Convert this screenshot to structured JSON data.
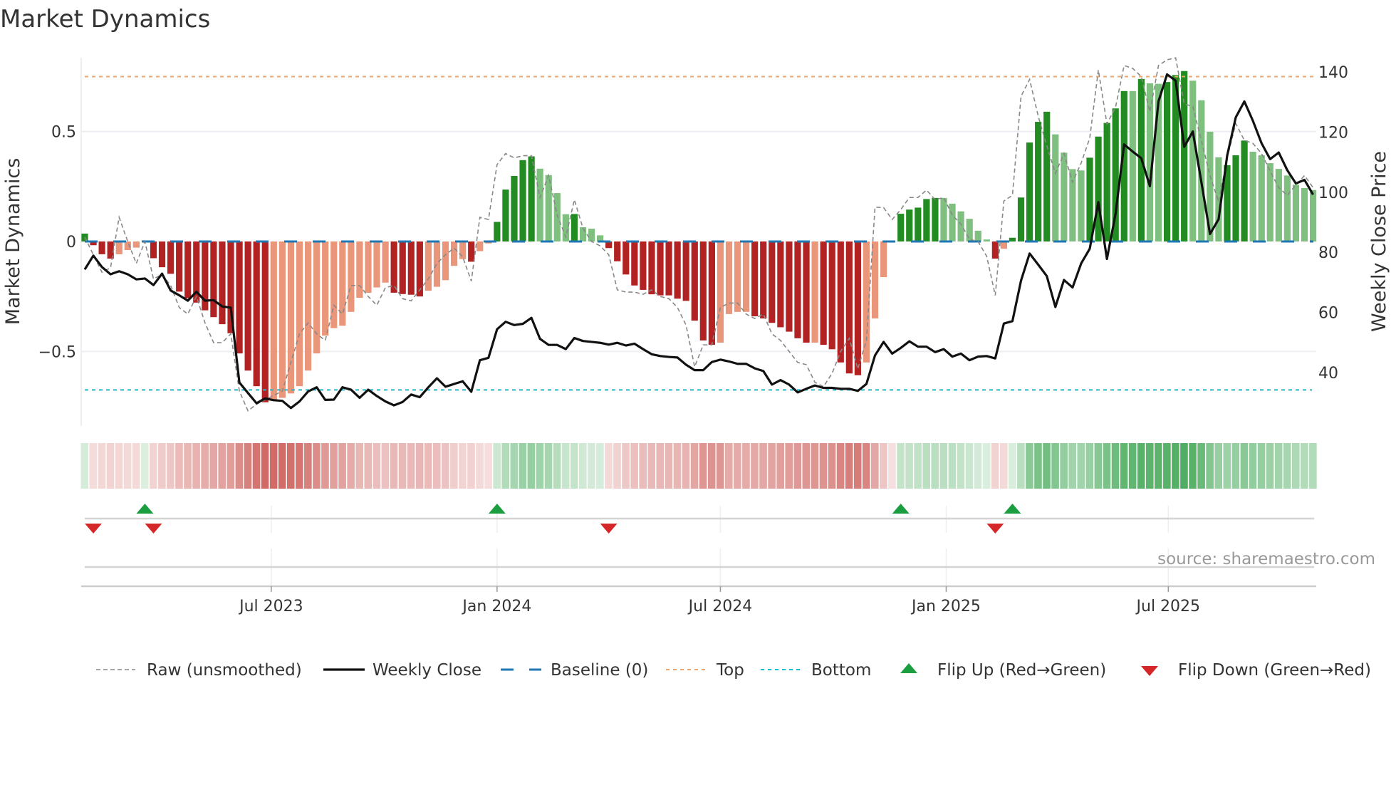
{
  "chart_data": {
    "type": "bar",
    "title": "Market Dynamics",
    "ylabel": "Market Dynamics",
    "y2label": "Weekly Close Price",
    "ylim": [
      -0.85,
      0.8
    ],
    "y2lim": [
      27,
      146
    ],
    "yticks": [
      {
        "v": 0.5,
        "label": "0.5"
      },
      {
        "v": 0,
        "label": "0"
      },
      {
        "v": -0.5,
        "label": "−0.5"
      }
    ],
    "y2ticks": [
      {
        "v": 140,
        "label": "140"
      },
      {
        "v": 120,
        "label": "120"
      },
      {
        "v": 100,
        "label": "100"
      },
      {
        "v": 80,
        "label": "80"
      },
      {
        "v": 60,
        "label": "60"
      },
      {
        "v": 40,
        "label": "40"
      }
    ],
    "start_date": "2023-01-30",
    "frequency": "weekly",
    "xticks": [
      {
        "date": "2023-07-01",
        "label": "Jul 2023"
      },
      {
        "date": "2024-01-01",
        "label": "Jan 2024"
      },
      {
        "date": "2024-07-01",
        "label": "Jul 2024"
      },
      {
        "date": "2025-01-01",
        "label": "Jan 2025"
      },
      {
        "date": "2025-07-01",
        "label": "Jul 2025"
      }
    ],
    "top_level": 0.75,
    "bottom_level": -0.675,
    "baseline": 0,
    "colors": {
      "dg": "#228b22",
      "lg": "#7fbf7f",
      "dr": "#b22222",
      "lr": "#e9967a",
      "raw": "#888888",
      "close": "#111111",
      "baseline": "#1f77b4",
      "top": "#f4a460",
      "bottom": "#17becf",
      "flip_up": "#1a9e3f",
      "flip_down": "#d62728",
      "heat_pos": "#3ca550",
      "heat_neg": "#c8504b"
    },
    "dynamics": [
      0.036,
      -0.017,
      -0.058,
      -0.078,
      -0.058,
      -0.039,
      -0.028,
      0.005,
      -0.076,
      -0.117,
      -0.147,
      -0.228,
      -0.258,
      -0.278,
      -0.313,
      -0.344,
      -0.376,
      -0.417,
      -0.509,
      -0.587,
      -0.658,
      -0.731,
      -0.72,
      -0.711,
      -0.691,
      -0.658,
      -0.587,
      -0.509,
      -0.428,
      -0.394,
      -0.383,
      -0.32,
      -0.256,
      -0.233,
      -0.209,
      -0.187,
      -0.233,
      -0.239,
      -0.242,
      -0.25,
      -0.224,
      -0.206,
      -0.176,
      -0.111,
      -0.08,
      -0.092,
      -0.044,
      -0.009,
      0.089,
      0.236,
      0.298,
      0.37,
      0.387,
      0.331,
      0.302,
      0.22,
      0.124,
      0.125,
      0.065,
      0.058,
      0.028,
      -0.03,
      -0.09,
      -0.15,
      -0.2,
      -0.22,
      -0.24,
      -0.245,
      -0.245,
      -0.26,
      -0.27,
      -0.36,
      -0.45,
      -0.47,
      -0.46,
      -0.33,
      -0.32,
      -0.32,
      -0.34,
      -0.35,
      -0.37,
      -0.39,
      -0.41,
      -0.44,
      -0.46,
      -0.46,
      -0.47,
      -0.49,
      -0.55,
      -0.6,
      -0.608,
      -0.55,
      -0.35,
      -0.162,
      -0.005,
      0.126,
      0.145,
      0.154,
      0.193,
      0.198,
      0.198,
      0.172,
      0.137,
      0.103,
      0.049,
      0.009,
      -0.078,
      -0.033,
      0.017,
      0.2,
      0.45,
      0.544,
      0.59,
      0.487,
      0.404,
      0.329,
      0.323,
      0.381,
      0.477,
      0.539,
      0.605,
      0.684,
      0.684,
      0.739,
      0.719,
      0.717,
      0.725,
      0.757,
      0.775,
      0.731,
      0.642,
      0.499,
      0.383,
      0.347,
      0.392,
      0.459,
      0.408,
      0.392,
      0.356,
      0.33,
      0.3,
      0.258,
      0.243,
      0.234
    ],
    "shade": [
      "dg",
      "dr",
      "dr",
      "dr",
      "lr",
      "lr",
      "lr",
      "lg",
      "dr",
      "dr",
      "dr",
      "dr",
      "dr",
      "dr",
      "dr",
      "dr",
      "dr",
      "dr",
      "dr",
      "dr",
      "dr",
      "dr",
      "lr",
      "lr",
      "lr",
      "lr",
      "lr",
      "lr",
      "lr",
      "lr",
      "lr",
      "lr",
      "lr",
      "lr",
      "lr",
      "lr",
      "dr",
      "dr",
      "dr",
      "dr",
      "lr",
      "lr",
      "lr",
      "lr",
      "lr",
      "dr",
      "lr",
      "lr",
      "dg",
      "dg",
      "dg",
      "dg",
      "dg",
      "lg",
      "lg",
      "lg",
      "lg",
      "dg",
      "lg",
      "lg",
      "lg",
      "dr",
      "dr",
      "dr",
      "dr",
      "dr",
      "dr",
      "dr",
      "dr",
      "dr",
      "dr",
      "dr",
      "dr",
      "dr",
      "lr",
      "lr",
      "lr",
      "lr",
      "dr",
      "dr",
      "dr",
      "dr",
      "dr",
      "dr",
      "dr",
      "lr",
      "dr",
      "dr",
      "dr",
      "dr",
      "dr",
      "lr",
      "lr",
      "lr",
      "lr",
      "dg",
      "dg",
      "dg",
      "dg",
      "dg",
      "lg",
      "lg",
      "lg",
      "lg",
      "lg",
      "lg",
      "dr",
      "lr",
      "dg",
      "dg",
      "dg",
      "dg",
      "dg",
      "lg",
      "lg",
      "lg",
      "lg",
      "dg",
      "dg",
      "dg",
      "dg",
      "dg",
      "lg",
      "dg",
      "lg",
      "lg",
      "dg",
      "dg",
      "dg",
      "lg",
      "lg",
      "lg",
      "lg",
      "dg",
      "dg",
      "dg",
      "lg",
      "lg",
      "lg",
      "lg",
      "lg",
      "lg",
      "lg",
      "lg"
    ],
    "raw": [
      0.02,
      -0.06,
      -0.14,
      -0.12,
      0.11,
      0.0,
      -0.1,
      0.0,
      -0.17,
      -0.15,
      -0.2,
      -0.3,
      -0.33,
      -0.25,
      -0.37,
      -0.46,
      -0.46,
      -0.42,
      -0.68,
      -0.77,
      -0.74,
      -0.72,
      -0.7,
      -0.68,
      -0.55,
      -0.42,
      -0.37,
      -0.42,
      -0.45,
      -0.29,
      -0.33,
      -0.2,
      -0.2,
      -0.25,
      -0.29,
      -0.21,
      -0.2,
      -0.26,
      -0.27,
      -0.22,
      -0.17,
      -0.1,
      -0.06,
      -0.03,
      -0.07,
      -0.18,
      0.11,
      0.1,
      0.35,
      0.4,
      0.38,
      0.39,
      0.39,
      0.2,
      0.3,
      0.12,
      0.02,
      0.19,
      0.06,
      0.0,
      -0.02,
      -0.06,
      -0.22,
      -0.23,
      -0.23,
      -0.24,
      -0.22,
      -0.25,
      -0.26,
      -0.3,
      -0.38,
      -0.57,
      -0.47,
      -0.47,
      -0.3,
      -0.28,
      -0.28,
      -0.33,
      -0.35,
      -0.33,
      -0.42,
      -0.45,
      -0.5,
      -0.55,
      -0.56,
      -0.64,
      -0.66,
      -0.6,
      -0.5,
      -0.44,
      -0.58,
      -0.45,
      0.156,
      0.154,
      0.1,
      0.145,
      0.2,
      0.2,
      0.234,
      0.19,
      0.2,
      0.12,
      0.08,
      0.01,
      0.0,
      -0.067,
      -0.245,
      0.184,
      0.21,
      0.66,
      0.737,
      0.57,
      0.435,
      0.31,
      0.4,
      0.27,
      0.357,
      0.47,
      0.78,
      0.535,
      0.61,
      0.8,
      0.787,
      0.75,
      0.59,
      0.8,
      0.826,
      0.835,
      0.625,
      0.614,
      0.458,
      0.3,
      0.18,
      0.38,
      0.536,
      0.46,
      0.446,
      0.4,
      0.32,
      0.245,
      0.21,
      0.257,
      0.3,
      0.245
    ],
    "close": [
      74.3,
      78.9,
      75.1,
      72.7,
      73.7,
      72.7,
      71.0,
      71.3,
      69.1,
      72.9,
      67.3,
      65.7,
      63.9,
      66.9,
      63.9,
      64.1,
      62.0,
      61.6,
      36.7,
      33.2,
      29.8,
      31.4,
      30.8,
      30.6,
      28.2,
      30.4,
      33.7,
      35.1,
      30.9,
      31.0,
      35.1,
      34.3,
      31.6,
      34.3,
      32.2,
      30.4,
      29.1,
      30.2,
      32.7,
      31.8,
      35.1,
      38.1,
      35.3,
      36.2,
      37.1,
      33.6,
      44.1,
      44.9,
      54.4,
      56.9,
      55.8,
      56.2,
      58.2,
      51.2,
      49.2,
      49.2,
      47.8,
      51.5,
      50.5,
      50.2,
      49.9,
      49.3,
      49.9,
      49.0,
      49.6,
      47.8,
      46.1,
      45.5,
      45.2,
      45.0,
      42.6,
      40.8,
      40.8,
      43.5,
      44.3,
      43.7,
      42.9,
      42.9,
      41.4,
      40.5,
      36.0,
      37.5,
      36.0,
      33.4,
      34.6,
      35.7,
      34.9,
      34.9,
      34.6,
      34.6,
      33.9,
      36.2,
      45.7,
      50.2,
      46.3,
      48.2,
      50.4,
      48.6,
      48.6,
      46.8,
      47.8,
      45.3,
      46.3,
      44.1,
      45.3,
      45.5,
      44.7,
      56.3,
      57.1,
      70.6,
      79.6,
      75.9,
      72.1,
      61.8,
      70.8,
      68.3,
      76.3,
      81.2,
      96.7,
      77.8,
      92.7,
      115.9,
      113.5,
      111.3,
      102.0,
      130.2,
      139.2,
      137.1,
      115.1,
      120.2,
      103.3,
      86.1,
      91.0,
      112.2,
      124.9,
      130.2,
      123.7,
      116.3,
      111.0,
      113.2,
      107.3,
      102.9,
      104.1,
      99.2
    ],
    "flip_up_weeks": [
      7,
      48,
      95,
      108
    ],
    "flip_down_weeks": [
      1,
      8,
      61,
      106
    ],
    "legend": {
      "raw": "Raw (unsmoothed)",
      "close": "Weekly Close",
      "baseline": "Baseline (0)",
      "top": "Top",
      "bottom": "Bottom",
      "flip_up": "Flip Up (Red→Green)",
      "flip_down": "Flip Down (Green→Red)"
    },
    "legend_placement": "bottom",
    "source": "source: sharemaestro.com"
  }
}
